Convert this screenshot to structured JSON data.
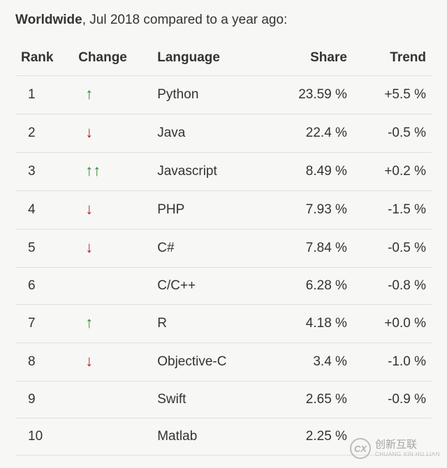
{
  "header": {
    "bold": "Worldwide",
    "rest": ", Jul 2018 compared to a year ago:"
  },
  "columns": {
    "rank": "Rank",
    "change": "Change",
    "language": "Language",
    "share": "Share",
    "trend": "Trend"
  },
  "rows": [
    {
      "rank": "1",
      "change": "up",
      "arrows": 1,
      "language": "Python",
      "share": "23.59 %",
      "trend": "+5.5 %"
    },
    {
      "rank": "2",
      "change": "down",
      "arrows": 1,
      "language": "Java",
      "share": "22.4 %",
      "trend": "-0.5 %"
    },
    {
      "rank": "3",
      "change": "up",
      "arrows": 2,
      "language": "Javascript",
      "share": "8.49 %",
      "trend": "+0.2 %"
    },
    {
      "rank": "4",
      "change": "down",
      "arrows": 1,
      "language": "PHP",
      "share": "7.93 %",
      "trend": "-1.5 %"
    },
    {
      "rank": "5",
      "change": "down",
      "arrows": 1,
      "language": "C#",
      "share": "7.84 %",
      "trend": "-0.5 %"
    },
    {
      "rank": "6",
      "change": "none",
      "arrows": 0,
      "language": "C/C++",
      "share": "6.28 %",
      "trend": "-0.8 %"
    },
    {
      "rank": "7",
      "change": "up",
      "arrows": 1,
      "language": "R",
      "share": "4.18 %",
      "trend": "+0.0 %"
    },
    {
      "rank": "8",
      "change": "down",
      "arrows": 1,
      "language": "Objective-C",
      "share": "3.4 %",
      "trend": "-1.0 %"
    },
    {
      "rank": "9",
      "change": "none",
      "arrows": 0,
      "language": "Swift",
      "share": "2.65 %",
      "trend": "-0.9 %"
    },
    {
      "rank": "10",
      "change": "none",
      "arrows": 0,
      "language": "Matlab",
      "share": "2.25 %",
      "trend": ""
    }
  ],
  "watermark": {
    "logo": "CX",
    "cn": "创新互联",
    "en": "CHUANG XIN HU LIAN"
  },
  "chart_data": {
    "type": "table",
    "title": "Worldwide, Jul 2018 compared to a year ago",
    "columns": [
      "Rank",
      "Change",
      "Language",
      "Share",
      "Trend"
    ],
    "data": [
      {
        "rank": 1,
        "change": "+1",
        "language": "Python",
        "share_pct": 23.59,
        "trend_pct": 5.5
      },
      {
        "rank": 2,
        "change": "-1",
        "language": "Java",
        "share_pct": 22.4,
        "trend_pct": -0.5
      },
      {
        "rank": 3,
        "change": "+2",
        "language": "Javascript",
        "share_pct": 8.49,
        "trend_pct": 0.2
      },
      {
        "rank": 4,
        "change": "-1",
        "language": "PHP",
        "share_pct": 7.93,
        "trend_pct": -1.5
      },
      {
        "rank": 5,
        "change": "-1",
        "language": "C#",
        "share_pct": 7.84,
        "trend_pct": -0.5
      },
      {
        "rank": 6,
        "change": "0",
        "language": "C/C++",
        "share_pct": 6.28,
        "trend_pct": -0.8
      },
      {
        "rank": 7,
        "change": "+1",
        "language": "R",
        "share_pct": 4.18,
        "trend_pct": 0.0
      },
      {
        "rank": 8,
        "change": "-1",
        "language": "Objective-C",
        "share_pct": 3.4,
        "trend_pct": -1.0
      },
      {
        "rank": 9,
        "change": "0",
        "language": "Swift",
        "share_pct": 2.65,
        "trend_pct": -0.9
      },
      {
        "rank": 10,
        "change": "0",
        "language": "Matlab",
        "share_pct": 2.25,
        "trend_pct": null
      }
    ]
  }
}
